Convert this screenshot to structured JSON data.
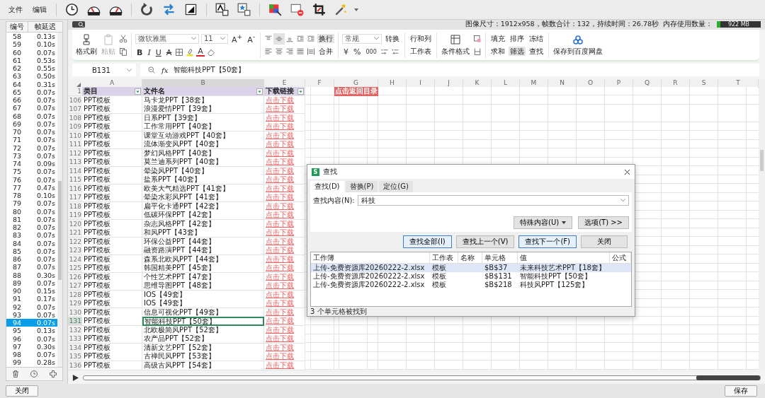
{
  "menu": [
    "文件",
    "编辑"
  ],
  "frames": {
    "columns": [
      "编号",
      "帧延迟"
    ],
    "rows": [
      {
        "number": "58",
        "delay": "0.13s",
        "selected": false
      },
      {
        "number": "59",
        "delay": "0.10s",
        "selected": false
      },
      {
        "number": "60",
        "delay": "0.07s",
        "selected": false
      },
      {
        "number": "61",
        "delay": "0.53s",
        "selected": false
      },
      {
        "number": "62",
        "delay": "0.55s",
        "selected": false
      },
      {
        "number": "63",
        "delay": "0.50s",
        "selected": false
      },
      {
        "number": "64",
        "delay": "0.31s",
        "selected": false
      },
      {
        "number": "65",
        "delay": "0.07s",
        "selected": false
      },
      {
        "number": "66",
        "delay": "0.07s",
        "selected": false
      },
      {
        "number": "67",
        "delay": "0.07s",
        "selected": false
      },
      {
        "number": "68",
        "delay": "0.07s",
        "selected": false
      },
      {
        "number": "69",
        "delay": "0.07s",
        "selected": false
      },
      {
        "number": "70",
        "delay": "0.07s",
        "selected": false
      },
      {
        "number": "71",
        "delay": "0.07s",
        "selected": false
      },
      {
        "number": "72",
        "delay": "0.07s",
        "selected": false
      },
      {
        "number": "73",
        "delay": "0.07s",
        "selected": false
      },
      {
        "number": "74",
        "delay": "0.09s",
        "selected": false
      },
      {
        "number": "75",
        "delay": "0.07s",
        "selected": false
      },
      {
        "number": "76",
        "delay": "0.07s",
        "selected": false
      },
      {
        "number": "77",
        "delay": "0.47s",
        "selected": false
      },
      {
        "number": "78",
        "delay": "0.10s",
        "selected": false
      },
      {
        "number": "79",
        "delay": "0.07s",
        "selected": false
      },
      {
        "number": "80",
        "delay": "0.07s",
        "selected": false
      },
      {
        "number": "81",
        "delay": "0.07s",
        "selected": false
      },
      {
        "number": "82",
        "delay": "0.07s",
        "selected": false
      },
      {
        "number": "83",
        "delay": "0.07s",
        "selected": false
      },
      {
        "number": "84",
        "delay": "0.07s",
        "selected": false
      },
      {
        "number": "85",
        "delay": "0.07s",
        "selected": false
      },
      {
        "number": "86",
        "delay": "0.07s",
        "selected": false
      },
      {
        "number": "87",
        "delay": "0.07s",
        "selected": false
      },
      {
        "number": "88",
        "delay": "0.30s",
        "selected": false
      },
      {
        "number": "89",
        "delay": "0.07s",
        "selected": false
      },
      {
        "number": "90",
        "delay": "0.15s",
        "selected": false
      },
      {
        "number": "91",
        "delay": "0.17s",
        "selected": false
      },
      {
        "number": "92",
        "delay": "0.07s",
        "selected": false
      },
      {
        "number": "93",
        "delay": "0.07s",
        "selected": false
      },
      {
        "number": "94",
        "delay": "0.07s",
        "selected": true
      },
      {
        "number": "95",
        "delay": "0.13s",
        "selected": false
      },
      {
        "number": "96",
        "delay": "0.07s",
        "selected": false
      },
      {
        "number": "97",
        "delay": "0.30s",
        "selected": false
      },
      {
        "number": "98",
        "delay": "0.07s",
        "selected": false
      },
      {
        "number": "99",
        "delay": "0.28s",
        "selected": false
      }
    ],
    "close_button": "关闭"
  },
  "status": {
    "info": "图像尺寸：1912x958，帧数合计：132，持续时间：26.78秒",
    "memory_label": "内存使用数量：",
    "memory_value": "922 MB",
    "level": 0.08
  },
  "ribbon": {
    "format_painter": "格式刷",
    "paste": {
      "label": "粘贴",
      "disabled": true
    },
    "font": "微软雅黑",
    "font_size": "11",
    "font_grow": "A$^{+}$",
    "font_shrink": "A$^{-}$",
    "styles": [
      {
        "label": "B",
        "kind": "bold"
      },
      {
        "label": "I",
        "kind": "italic"
      },
      {
        "label": "U",
        "kind": "underline"
      },
      {
        "label": "A",
        "kind": "strike"
      }
    ],
    "font_color": "A",
    "vertical_align": [
      {
        "selected": false
      },
      {
        "selected": true
      },
      {
        "selected": false
      }
    ],
    "wrap": {
      "label": "换行",
      "on": true
    },
    "merge": "合并",
    "number_format": "常规",
    "convert": "转换",
    "currency": "¥",
    "percent": "%",
    "thousands": "000",
    "rows_cols": "行和列",
    "worksheet": "工作表",
    "conditional": "条件格式",
    "fill": "填充",
    "sort": "排序",
    "freeze": "冻结",
    "sum": "求和",
    "filter": {
      "label": "筛选",
      "on": true
    },
    "find": "查找",
    "cloud_save": "保存到百度网盘"
  },
  "formula_bar": {
    "cell": "B131",
    "fx": "fx",
    "content": "智能科技PPT【50套】"
  },
  "sheet": {
    "columns": [
      {
        "letter": "A",
        "selected": false
      },
      {
        "letter": "B",
        "selected": true
      },
      {
        "letter": "E",
        "selected": false
      },
      {
        "letter": "F",
        "selected": false
      },
      {
        "letter": "G",
        "selected": false
      },
      {
        "letter": "H",
        "selected": false
      },
      {
        "letter": "I",
        "selected": false
      },
      {
        "letter": "J",
        "selected": false
      },
      {
        "letter": "K",
        "selected": false
      },
      {
        "letter": "L",
        "selected": false
      },
      {
        "letter": "M",
        "selected": false
      },
      {
        "letter": "N",
        "selected": false
      },
      {
        "letter": "O",
        "selected": false
      },
      {
        "letter": "P",
        "selected": false
      },
      {
        "letter": "Q",
        "selected": false
      },
      {
        "letter": "R",
        "selected": false
      },
      {
        "letter": "S",
        "selected": false
      },
      {
        "letter": "T",
        "selected": false
      }
    ],
    "header_row": {
      "number": "1",
      "cells": [
        "类目",
        "文件名",
        "下载链接"
      ],
      "return_link": "点击返回目录"
    },
    "rows": [
      {
        "number": "106",
        "category": "PPT模板",
        "name": "马卡龙PPT【38套】",
        "link": "点击下载",
        "selected": false
      },
      {
        "number": "107",
        "category": "PPT模板",
        "name": "浪漫爱情PPT【39套】",
        "link": "点击下载",
        "selected": false
      },
      {
        "number": "108",
        "category": "PPT模板",
        "name": "日系PPT【39套】",
        "link": "点击下载",
        "selected": false
      },
      {
        "number": "109",
        "category": "PPT模板",
        "name": "工作常用PPT【40套】",
        "link": "点击下载",
        "selected": false
      },
      {
        "number": "110",
        "category": "PPT模板",
        "name": "课堂互动游戏PPT【40套】",
        "link": "点击下载",
        "selected": false
      },
      {
        "number": "111",
        "category": "PPT模板",
        "name": "流体渐变风PPT【40套】",
        "link": "点击下载",
        "selected": false
      },
      {
        "number": "112",
        "category": "PPT模板",
        "name": "梦幻风格PPT【40套】",
        "link": "点击下载",
        "selected": false
      },
      {
        "number": "113",
        "category": "PPT模板",
        "name": "莫兰迪系列PPT【40套】",
        "link": "点击下载",
        "selected": false
      },
      {
        "number": "114",
        "category": "PPT模板",
        "name": "晕染风PPT【40套】",
        "link": "点击下载",
        "selected": false
      },
      {
        "number": "115",
        "category": "PPT模板",
        "name": "盐系PPT【40套】",
        "link": "点击下载",
        "selected": false
      },
      {
        "number": "116",
        "category": "PPT模板",
        "name": "欧美大气精选PPT【41套】",
        "link": "点击下载",
        "selected": false
      },
      {
        "number": "117",
        "category": "PPT模板",
        "name": "晕染水彩风PPT【41套】",
        "link": "点击下载",
        "selected": false
      },
      {
        "number": "118",
        "category": "PPT模板",
        "name": "扁平化卡通PPT【42套】",
        "link": "点击下载",
        "selected": false
      },
      {
        "number": "119",
        "category": "PPT模板",
        "name": "低碳环保PPT【42套】",
        "link": "点击下载",
        "selected": false
      },
      {
        "number": "120",
        "category": "PPT模板",
        "name": "杂志风格PPT【42套】",
        "link": "点击下载",
        "selected": false
      },
      {
        "number": "121",
        "category": "PPT模板",
        "name": "和风PPT【43套】",
        "link": "点击下载",
        "selected": false
      },
      {
        "number": "122",
        "category": "PPT模板",
        "name": "环保公益PPT【44套】",
        "link": "点击下载",
        "selected": false
      },
      {
        "number": "123",
        "category": "PPT模板",
        "name": "融资路演PPT【44套】",
        "link": "点击下载",
        "selected": false
      },
      {
        "number": "124",
        "category": "PPT模板",
        "name": "森系北欧风PPT【44套】",
        "link": "点击下载",
        "selected": false
      },
      {
        "number": "125",
        "category": "PPT模板",
        "name": "韩国精美PPT【45套】",
        "link": "点击下载",
        "selected": false
      },
      {
        "number": "126",
        "category": "PPT模板",
        "name": "个性艺术PPT【47套】",
        "link": "点击下载",
        "selected": false
      },
      {
        "number": "127",
        "category": "PPT模板",
        "name": "思维导图PPT【48套】",
        "link": "点击下载",
        "selected": false
      },
      {
        "number": "128",
        "category": "PPT模板",
        "name": "IOS【49套】",
        "link": "点击下载",
        "selected": false
      },
      {
        "number": "129",
        "category": "PPT模板",
        "name": "IOS【49套】",
        "link": "点击下载",
        "selected": false
      },
      {
        "number": "130",
        "category": "PPT模板",
        "name": "信息可视化PPT【49套】",
        "link": "点击下载",
        "selected": false
      },
      {
        "number": "131",
        "category": "PPT模板",
        "name": "智能科技PPT【50套】",
        "link": "点击下载",
        "selected": true
      },
      {
        "number": "132",
        "category": "PPT模板",
        "name": "北欧极简风PPT【52套】",
        "link": "点击下载",
        "selected": false
      },
      {
        "number": "133",
        "category": "PPT模板",
        "name": "农产品PPT【52套】",
        "link": "点击下载",
        "selected": false
      },
      {
        "number": "134",
        "category": "PPT模板",
        "name": "清新文艺PPT【52套】",
        "link": "点击下载",
        "selected": false
      },
      {
        "number": "135",
        "category": "PPT模板",
        "name": "古禅民风PPT【53套】",
        "link": "点击下载",
        "selected": false
      },
      {
        "number": "136",
        "category": "PPT模板",
        "name": "高级古风PPT【54套】",
        "link": "点击下载",
        "selected": false
      }
    ]
  },
  "find_dialog": {
    "app_badge": "S",
    "title": "查找",
    "tabs": [
      {
        "label": "查找(D)",
        "selected": true
      },
      {
        "label": "替换(P)",
        "selected": false
      },
      {
        "label": "定位(G)",
        "selected": false
      }
    ],
    "search_label": "查找内容(N):",
    "search_value": "科技",
    "special_button": "特殊内容(U)",
    "options_button": "选项(T) >>",
    "buttons": [
      {
        "label": "查找全部(I)",
        "kind": "focused"
      },
      {
        "label": "查找上一个(V)",
        "kind": "normal"
      },
      {
        "label": "查找下一个(F)",
        "kind": "focused"
      },
      {
        "label": "关闭",
        "kind": "normal"
      }
    ],
    "results": {
      "columns": [
        "工作簿",
        "工作表",
        "名称",
        "单元格",
        "值",
        "公式"
      ],
      "rows": [
        {
          "workbook": "上传-免费资源库20260222-2.xlsx",
          "sheet": "模板",
          "cell": "$B$37",
          "value": "未来科技艺术PPT【18套】",
          "selected": true
        },
        {
          "workbook": "上传-免费资源库20260222-2.xlsx",
          "sheet": "模板",
          "cell": "$B$131",
          "value": "智能科技PPT【50套】",
          "selected": false
        },
        {
          "workbook": "上传-免费资源库20260222-2.xlsx",
          "sheet": "模板",
          "cell": "$B$218",
          "value": "科技风PPT【125套】",
          "selected": false
        }
      ]
    },
    "status": "3 个单元格被找到"
  },
  "save_button": "保存"
}
